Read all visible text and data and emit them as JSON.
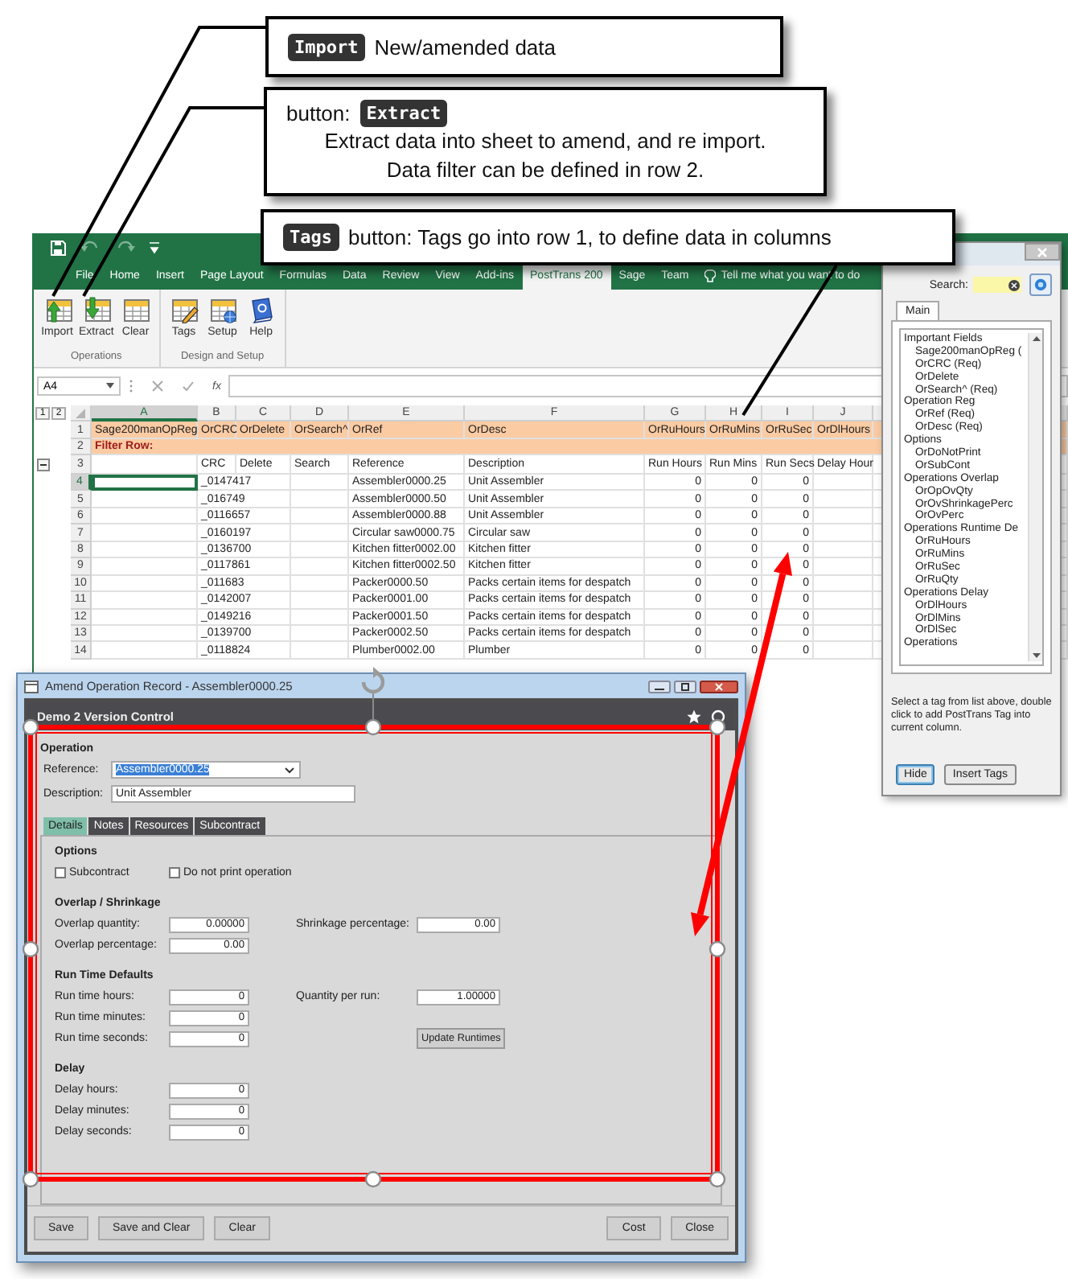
{
  "callouts": [
    {
      "kind": "inline",
      "badge": "Import",
      "text": "New/amended data"
    },
    {
      "kind": "stacked",
      "prefix": "button:",
      "badge": "Extract",
      "lines": [
        "Extract data into sheet to amend, and re import.",
        "Data filter can be defined in row 2."
      ]
    },
    {
      "kind": "inline",
      "badge": "Tags",
      "text": "button:  Tags go into row 1, to define data in columns"
    }
  ],
  "excel": {
    "ribbon_tabs": [
      {
        "label": "File",
        "selected": false
      },
      {
        "label": "Home",
        "selected": false
      },
      {
        "label": "Insert",
        "selected": false
      },
      {
        "label": "Page Layout",
        "selected": false
      },
      {
        "label": "Formulas",
        "selected": false
      },
      {
        "label": "Data",
        "selected": false
      },
      {
        "label": "Review",
        "selected": false
      },
      {
        "label": "View",
        "selected": false
      },
      {
        "label": "Add-ins",
        "selected": false
      },
      {
        "label": "PostTrans 200",
        "selected": true
      },
      {
        "label": "Sage",
        "selected": false
      },
      {
        "label": "Team",
        "selected": false
      }
    ],
    "tell_me": "Tell me what you want to do",
    "ribbon_groups": [
      {
        "label": "Operations",
        "buttons": [
          {
            "label": "Import",
            "kind": "import"
          },
          {
            "label": "Extract",
            "kind": "extract"
          },
          {
            "label": "Clear",
            "kind": "clear"
          }
        ]
      },
      {
        "label": "Design and Setup",
        "buttons": [
          {
            "label": "Tags",
            "kind": "tags"
          },
          {
            "label": "Setup",
            "kind": "setup"
          },
          {
            "label": "Help",
            "kind": "help"
          }
        ]
      }
    ],
    "name_box": "A4",
    "function_label": "fx",
    "outline_levels": [
      "1",
      "2"
    ],
    "columns": [
      {
        "letter": "A",
        "selected": true
      },
      {
        "letter": "B",
        "selected": false
      },
      {
        "letter": "C",
        "selected": false
      },
      {
        "letter": "D",
        "selected": false
      },
      {
        "letter": "E",
        "selected": false
      },
      {
        "letter": "F",
        "selected": false
      },
      {
        "letter": "G",
        "selected": false
      },
      {
        "letter": "H",
        "selected": false
      },
      {
        "letter": "I",
        "selected": false
      },
      {
        "letter": "J",
        "selected": false
      }
    ],
    "rows": [
      {
        "number": "1",
        "kind": "tags",
        "selected": false,
        "cells": [
          "Sage200manOpReg",
          "OrCRC",
          "OrDelete",
          "OrSearch^",
          "OrRef",
          "OrDesc",
          "OrRuHours",
          "OrRuMins",
          "OrRuSec",
          "OrDlHours"
        ]
      },
      {
        "number": "2",
        "kind": "filter",
        "selected": false,
        "cells": [
          "Filter Row:"
        ]
      },
      {
        "number": "3",
        "kind": "header",
        "selected": false,
        "cells": [
          null,
          "CRC",
          "Delete",
          "Search",
          "Reference",
          "Description",
          "Run Hours",
          "Run Mins",
          "Run Secs",
          "Delay Hour"
        ]
      },
      {
        "number": "4",
        "kind": "data",
        "selected": true,
        "cells": [
          null,
          "_0147417",
          null,
          null,
          "Assembler0000.25",
          "Unit Assembler",
          "0",
          "0",
          "0",
          null
        ]
      },
      {
        "number": "5",
        "kind": "data",
        "selected": false,
        "cells": [
          null,
          "_016749",
          null,
          null,
          "Assembler0000.50",
          "Unit Assembler",
          "0",
          "0",
          "0",
          null
        ]
      },
      {
        "number": "6",
        "kind": "data",
        "selected": false,
        "cells": [
          null,
          "_0116657",
          null,
          null,
          "Assembler0000.88",
          "Unit Assembler",
          "0",
          "0",
          "0",
          null
        ]
      },
      {
        "number": "7",
        "kind": "data",
        "selected": false,
        "cells": [
          null,
          "_0160197",
          null,
          null,
          "Circular saw0000.75",
          "Circular saw",
          "0",
          "0",
          "0",
          null
        ]
      },
      {
        "number": "8",
        "kind": "data",
        "selected": false,
        "cells": [
          null,
          "_0136700",
          null,
          null,
          "Kitchen fitter0002.00",
          "Kitchen fitter",
          "0",
          "0",
          "0",
          null
        ]
      },
      {
        "number": "9",
        "kind": "data",
        "selected": false,
        "cells": [
          null,
          "_0117861",
          null,
          null,
          "Kitchen fitter0002.50",
          "Kitchen fitter",
          "0",
          "0",
          "0",
          null
        ]
      },
      {
        "number": "10",
        "kind": "data",
        "selected": false,
        "cells": [
          null,
          "_011683",
          null,
          null,
          "Packer0000.50",
          "Packs certain items for despatch",
          "0",
          "0",
          "0",
          null
        ]
      },
      {
        "number": "11",
        "kind": "data",
        "selected": false,
        "cells": [
          null,
          "_0142007",
          null,
          null,
          "Packer0001.00",
          "Packs certain items for despatch",
          "0",
          "0",
          "0",
          null
        ]
      },
      {
        "number": "12",
        "kind": "data",
        "selected": false,
        "cells": [
          null,
          "_0149216",
          null,
          null,
          "Packer0001.50",
          "Packs certain items for despatch",
          "0",
          "0",
          "0",
          null
        ]
      },
      {
        "number": "13",
        "kind": "data",
        "selected": false,
        "cells": [
          null,
          "_0139700",
          null,
          null,
          "Packer0002.50",
          "Packs certain items for despatch",
          "0",
          "0",
          "0",
          null
        ]
      },
      {
        "number": "14",
        "kind": "data",
        "selected": false,
        "cells": [
          null,
          "_0118824",
          null,
          null,
          "Plumber0002.00",
          "Plumber",
          "0",
          "0",
          "0",
          null
        ]
      }
    ]
  },
  "tags_panel": {
    "search_label": "Search:",
    "tabs": [
      {
        "label": "Main",
        "selected": true
      }
    ],
    "tree": [
      {
        "label": "Important Fields",
        "children": [
          {
            "label": "Sage200manOpReg ("
          },
          {
            "label": "OrCRC (Req)"
          },
          {
            "label": "OrDelete"
          },
          {
            "label": "OrSearch^ (Req)"
          }
        ]
      },
      {
        "label": "Operation Reg",
        "children": [
          {
            "label": "OrRef (Req)"
          },
          {
            "label": "OrDesc (Req)"
          }
        ]
      },
      {
        "label": "Options",
        "children": [
          {
            "label": "OrDoNotPrint"
          },
          {
            "label": "OrSubCont"
          }
        ]
      },
      {
        "label": "Operations Overlap",
        "children": [
          {
            "label": "OrOpOvQty"
          },
          {
            "label": "OrOvShrinkagePerc"
          },
          {
            "label": "OrOvPerc"
          }
        ]
      },
      {
        "label": "Operations Runtime De",
        "children": [
          {
            "label": "OrRuHours"
          },
          {
            "label": "OrRuMins"
          },
          {
            "label": "OrRuSec"
          },
          {
            "label": "OrRuQty"
          }
        ]
      },
      {
        "label": "Operations Delay",
        "children": [
          {
            "label": "OrDlHours"
          },
          {
            "label": "OrDlMins"
          },
          {
            "label": "OrDlSec"
          }
        ]
      },
      {
        "label": "Operations"
      }
    ],
    "hint": "Select a tag from list above, double click to add PostTrans Tag into current column.",
    "buttons": [
      "Hide",
      "Insert Tags"
    ]
  },
  "dialog": {
    "title": "Amend Operation Record - Assembler0000.25",
    "header": "Demo 2 Version Control",
    "section": "Operation",
    "reference": {
      "label": "Reference:",
      "value": "Assembler0000.25"
    },
    "description": {
      "label": "Description:",
      "value": "Unit Assembler"
    },
    "tabs": [
      {
        "label": "Details",
        "selected": true
      },
      {
        "label": "Notes",
        "selected": false
      },
      {
        "label": "Resources",
        "selected": false
      },
      {
        "label": "Subcontract",
        "selected": false
      }
    ],
    "groups": [
      {
        "title": "Options",
        "rows": [
          [
            {
              "kind": "checkbox",
              "label": "Subcontract",
              "checked": false
            },
            {
              "kind": "checkbox",
              "label": "Do not print operation",
              "checked": false
            }
          ]
        ]
      },
      {
        "title": "Overlap / Shrinkage",
        "rows": [
          [
            {
              "kind": "field",
              "label": "Overlap quantity:",
              "value": "0.00000"
            },
            {
              "kind": "field",
              "label": "Shrinkage percentage:",
              "value": "0.00"
            }
          ],
          [
            {
              "kind": "field",
              "label": "Overlap percentage:",
              "value": "0.00"
            }
          ]
        ]
      },
      {
        "title": "Run Time Defaults",
        "rows": [
          [
            {
              "kind": "field",
              "label": "Run time hours:",
              "value": "0"
            },
            {
              "kind": "field",
              "label": "Quantity per run:",
              "value": "1.00000"
            }
          ],
          [
            {
              "kind": "field",
              "label": "Run time minutes:",
              "value": "0"
            }
          ],
          [
            {
              "kind": "field",
              "label": "Run time seconds:",
              "value": "0"
            },
            {
              "kind": "button",
              "label": "Update Runtimes"
            }
          ]
        ]
      },
      {
        "title": "Delay",
        "rows": [
          [
            {
              "kind": "field",
              "label": "Delay hours:",
              "value": "0"
            }
          ],
          [
            {
              "kind": "field",
              "label": "Delay minutes:",
              "value": "0"
            }
          ],
          [
            {
              "kind": "field",
              "label": "Delay seconds:",
              "value": "0"
            }
          ]
        ]
      }
    ],
    "buttons_left": [
      "Save",
      "Save and Clear",
      "Clear"
    ],
    "buttons_right": [
      "Cost",
      "Close"
    ]
  }
}
